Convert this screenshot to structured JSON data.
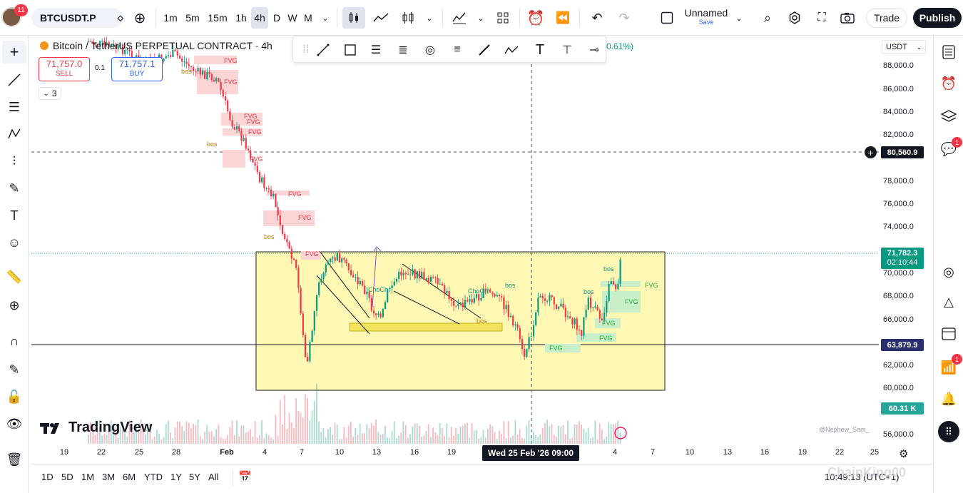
{
  "topbar": {
    "notification_count": "11",
    "symbol": "BTCUSDT.P",
    "intervals": [
      "1m",
      "5m",
      "15m",
      "1h",
      "4h",
      "D",
      "W",
      "M"
    ],
    "active_interval": "4h",
    "layout_name": "Unnamed",
    "layout_status": "Save",
    "trade_label": "Trade",
    "publish_label": "Publish"
  },
  "legend": {
    "title": "Bitcoin / TetherUS PERPETUAL CONTRACT · 4h",
    "change": "0.61%)",
    "sell_price": "71,757.0",
    "sell_label": "SELL",
    "spread": "0.1",
    "buy_price": "71,757.1",
    "buy_label": "BUY",
    "indicators_count": "3"
  },
  "price_axis": {
    "currency": "USDT",
    "labels": [
      "88,000.0",
      "86,000.0",
      "84,000.0",
      "82,000.0",
      "78,000.0",
      "76,000.0",
      "74,000.0",
      "70,000.0",
      "68,000.0",
      "66,000.0",
      "62,000.0",
      "60,000.0",
      "56,000.0"
    ],
    "crosshair_price": "80,560.9",
    "last_price": "71,782.3",
    "countdown": "02:10:44",
    "line_price": "63,879.9",
    "volume": "60.31 K"
  },
  "time_axis": {
    "labels": [
      "19",
      "22",
      "25",
      "28",
      "Feb",
      "4",
      "7",
      "10",
      "13",
      "16",
      "19",
      "4",
      "7",
      "10",
      "13",
      "16",
      "19",
      "22",
      "25"
    ],
    "crosshair_date": "Wed 25 Feb '26   09:00"
  },
  "annotations": {
    "fvg": "FVG",
    "bos": "bos",
    "choch": "ChoCh"
  },
  "bottombar": {
    "ranges": [
      "1D",
      "5D",
      "1M",
      "3M",
      "6M",
      "YTD",
      "1Y",
      "5Y",
      "All"
    ],
    "clock": "10:49:13 (UTC+1)"
  },
  "branding": {
    "logo_text": "TradingView",
    "author": "@Nephew_Sam_",
    "watermark": "ChainKing00"
  },
  "colors": {
    "up": "#089981",
    "down": "#f23645",
    "range_box": "#fff59d",
    "fvg_red": "#fbd5d5",
    "fvg_green": "#c8efc8"
  },
  "right_toolbar": {
    "alerts_badge": "1",
    "ideas_badge": "1"
  }
}
